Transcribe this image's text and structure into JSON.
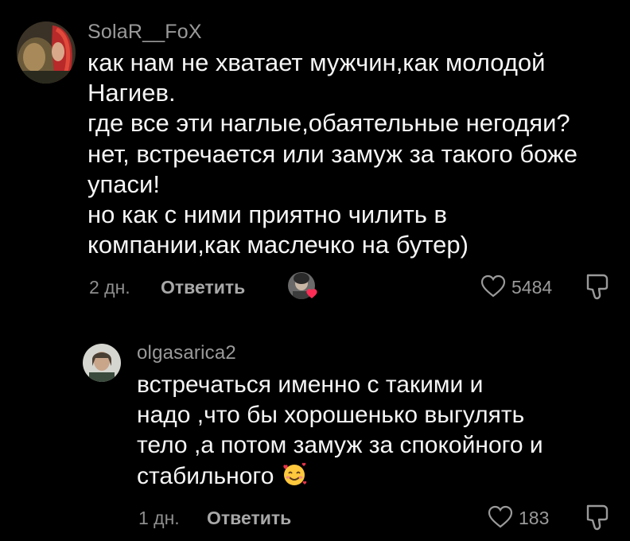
{
  "comments": [
    {
      "username": "SolaR__FoX",
      "lines": [
        "как нам не хватает мужчин,как молодой",
        "Нагиев.",
        "где все эти наглые,обаятельные негодяи?",
        "нет, встречается или замуж за такого боже",
        "упаси!",
        "но как с ними приятно чилить в",
        "компании,как маслечко на бутер)"
      ],
      "time": "2 дн.",
      "reply_label": "Ответить",
      "likes": "5484",
      "author_liked": true
    },
    {
      "username": "olgasarica2",
      "lines": [
        "встречаться именно с такими и",
        "надо ,что бы хорошенько выгулять",
        "тело ,а потом замуж за спокойного и",
        "стабильного"
      ],
      "trailing_emoji": "smiling-face-with-hearts",
      "time": "1 дн.",
      "reply_label": "Ответить",
      "likes": "183"
    }
  ],
  "colors": {
    "background": "#000000",
    "text": "#f5f5f5",
    "muted": "#8e8e8e",
    "heart": "#fe2c55"
  }
}
